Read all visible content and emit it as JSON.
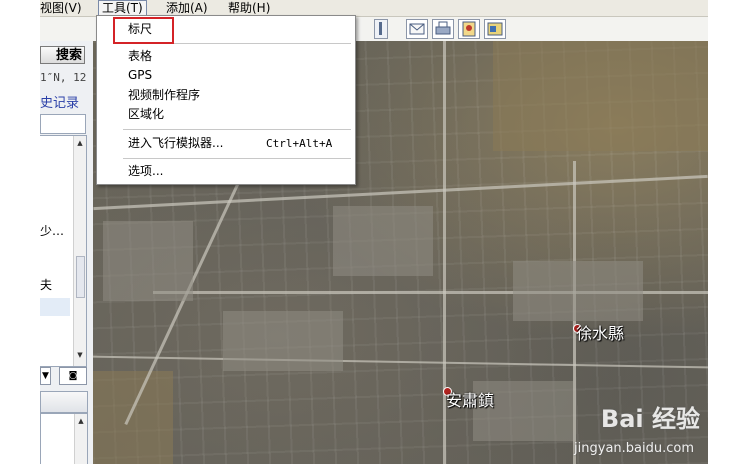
{
  "menubar": {
    "items": [
      "视图(V)",
      "工具(T)",
      "添加(A)",
      "帮助(H)"
    ]
  },
  "left_panel": {
    "search_label": "搜索",
    "coordinates": "1″N, 12",
    "history_label": "史记录",
    "list_items": [
      "少…",
      "夫"
    ]
  },
  "tools_menu": {
    "items": [
      {
        "label": "标尺",
        "shortcut": ""
      },
      {
        "label": "表格",
        "shortcut": ""
      },
      {
        "label": "GPS",
        "shortcut": ""
      },
      {
        "label": "视频制作程序",
        "shortcut": ""
      },
      {
        "label": "区域化",
        "shortcut": ""
      },
      {
        "label": "进入飞行模拟器...",
        "shortcut": "Ctrl+Alt+A"
      },
      {
        "label": "选项...",
        "shortcut": ""
      }
    ]
  },
  "map": {
    "places": [
      "徐水縣",
      "安肅鎮"
    ]
  },
  "watermark": {
    "brand": "Bai 经验",
    "url": "jingyan.baidu.com"
  },
  "colors": {
    "highlight_box": "#d42327",
    "history_link": "#2a3fa8",
    "pin": "#b0231f"
  }
}
